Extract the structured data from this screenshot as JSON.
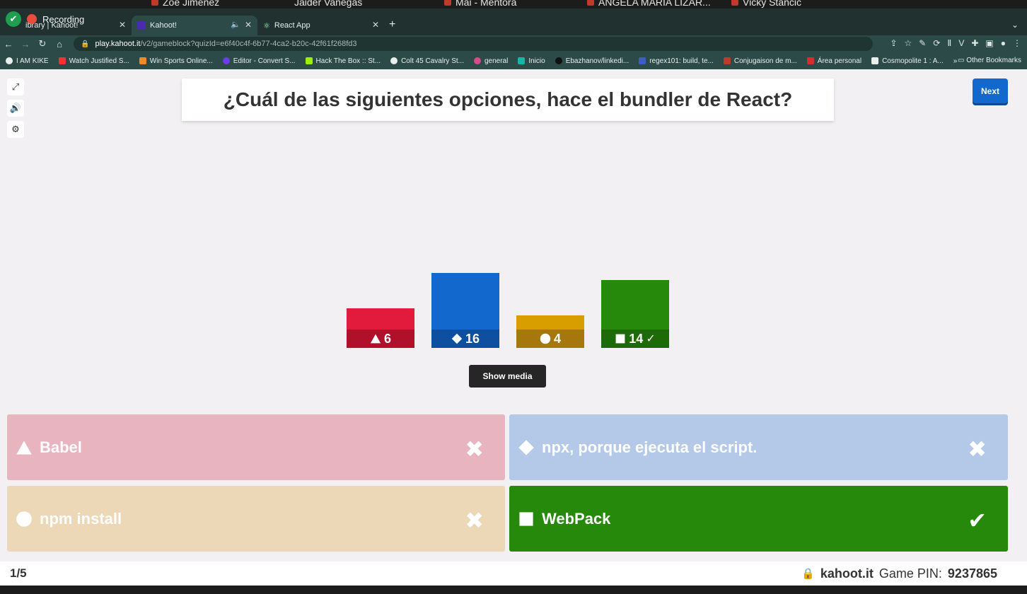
{
  "video_strip": {
    "participants": [
      "Zoe Jimenez",
      "Jaider Vanegas",
      "Mai - Mentora",
      "ANGELA MARIA LIZAR...",
      "Vicky Stancic"
    ]
  },
  "recording": {
    "label": "Recording"
  },
  "tabs": [
    {
      "label": "ibrary | Kahoot!"
    },
    {
      "label": "Kahoot!"
    },
    {
      "label": "React App"
    }
  ],
  "address": {
    "host": "play.kahoot.it",
    "path": "/v2/gameblock?quizId=e6f40c4f-6b77-4ca2-b20c-42f61f268fd3"
  },
  "bookmarks": [
    "I AM KIKE",
    "Watch Justified S...",
    "Win Sports Online...",
    "Editor - Convert S...",
    "Hack The Box :: St...",
    "Colt 45 Cavalry St...",
    "general",
    "Inicio",
    "Ebazhanov/linkedi...",
    "regex101: build, te...",
    "Conjugaison de m...",
    "Área personal",
    "Cosmopolite 1 : A...",
    "»"
  ],
  "other_bookmarks": "Other Bookmarks",
  "question": {
    "text": "¿Cuál de las siguientes opciones, hace el bundler de React?"
  },
  "next_button": {
    "label": "Next"
  },
  "results": [
    {
      "shape": "triangle",
      "count": "6",
      "fraction": 0.15,
      "color": "#e21b3c",
      "dark": "#b0102a"
    },
    {
      "shape": "diamond",
      "count": "16",
      "fraction": 0.4,
      "color": "#1368ce",
      "dark": "#0f4fa0"
    },
    {
      "shape": "circle",
      "count": "4",
      "fraction": 0.1,
      "color": "#d89e00",
      "dark": "#a5770d"
    },
    {
      "shape": "square",
      "count": "14",
      "fraction": 0.35,
      "color": "#26890c",
      "dark": "#1d6a09",
      "correct_mark": "✓"
    }
  ],
  "show_media": {
    "label": "Show media"
  },
  "answers": [
    {
      "shape": "triangle",
      "text": "Babel",
      "correct": false,
      "color": "#e8b4c0"
    },
    {
      "shape": "diamond",
      "text": "npx, porque ejecuta el script.",
      "correct": false,
      "color": "#b4c9e8"
    },
    {
      "shape": "circle",
      "text": "npm install",
      "correct": false,
      "color": "#ecd7b6"
    },
    {
      "shape": "square",
      "text": "WebPack",
      "correct": true,
      "color": "#26890c"
    }
  ],
  "footer": {
    "progress": "1/5",
    "brand": "kahoot.it",
    "pin_label": "Game PIN:",
    "pin": "9237865"
  }
}
